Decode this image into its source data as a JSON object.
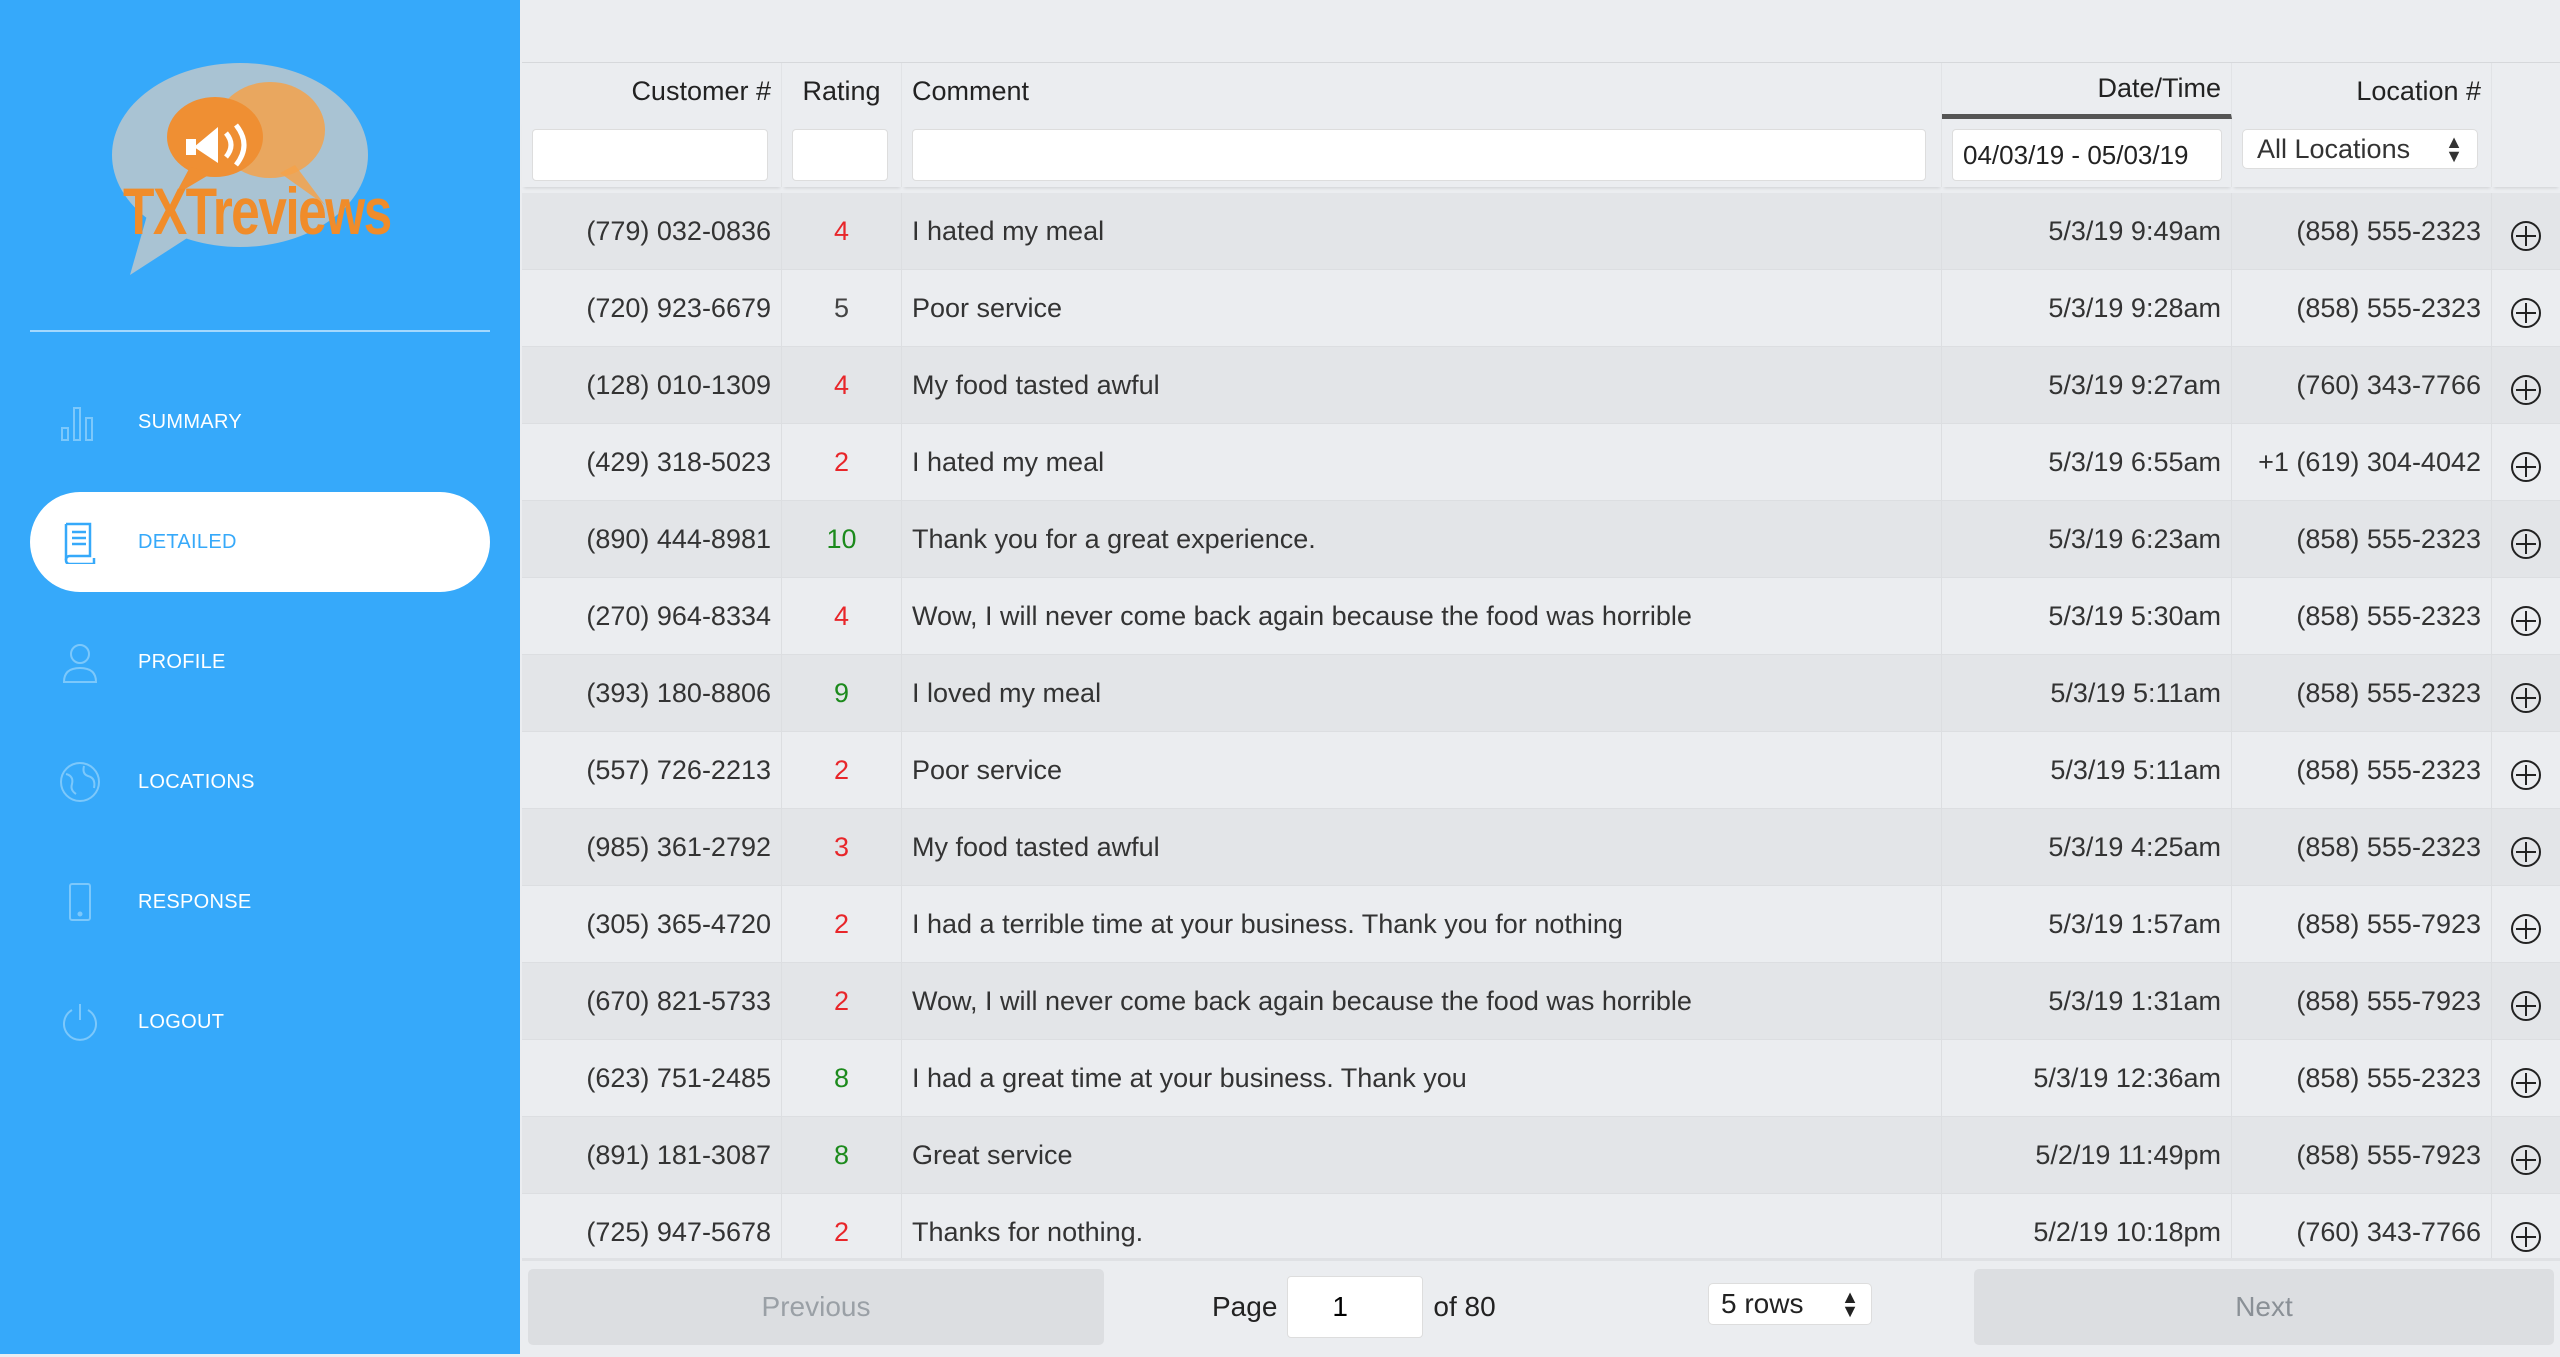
{
  "logo": {
    "text": "TXTreviews"
  },
  "nav": [
    {
      "label": "SUMMARY",
      "icon": "bar-chart-icon",
      "active": false
    },
    {
      "label": "DETAILED",
      "icon": "document-icon",
      "active": true
    },
    {
      "label": "PROFILE",
      "icon": "user-icon",
      "active": false
    },
    {
      "label": "LOCATIONS",
      "icon": "globe-icon",
      "active": false
    },
    {
      "label": "RESPONSE",
      "icon": "phone-icon",
      "active": false
    },
    {
      "label": "LOGOUT",
      "icon": "power-icon",
      "active": false
    }
  ],
  "table": {
    "headers": {
      "customer": "Customer #",
      "rating": "Rating",
      "comment": "Comment",
      "datetime": "Date/Time",
      "location": "Location #"
    },
    "filters": {
      "customer": "",
      "rating": "",
      "comment": "",
      "date_range": "04/03/19 - 05/03/19",
      "location": "All Locations"
    },
    "rows": [
      {
        "customer": "(779) 032-0836",
        "rating": "4",
        "comment": "I hated my meal",
        "datetime": "5/3/19 9:49am",
        "location": "(858) 555-2323"
      },
      {
        "customer": "(720) 923-6679",
        "rating": "5",
        "comment": "Poor service",
        "datetime": "5/3/19 9:28am",
        "location": "(858) 555-2323"
      },
      {
        "customer": "(128) 010-1309",
        "rating": "4",
        "comment": "My food tasted awful",
        "datetime": "5/3/19 9:27am",
        "location": "(760) 343-7766"
      },
      {
        "customer": "(429) 318-5023",
        "rating": "2",
        "comment": "I hated my meal",
        "datetime": "5/3/19 6:55am",
        "location": "+1 (619) 304-4042"
      },
      {
        "customer": "(890) 444-8981",
        "rating": "10",
        "comment": "Thank you for a great experience.",
        "datetime": "5/3/19 6:23am",
        "location": "(858) 555-2323"
      },
      {
        "customer": "(270) 964-8334",
        "rating": "4",
        "comment": "Wow, I will never come back again because the food was horrible",
        "datetime": "5/3/19 5:30am",
        "location": "(858) 555-2323"
      },
      {
        "customer": "(393) 180-8806",
        "rating": "9",
        "comment": "I loved my meal",
        "datetime": "5/3/19 5:11am",
        "location": "(858) 555-2323"
      },
      {
        "customer": "(557) 726-2213",
        "rating": "2",
        "comment": "Poor service",
        "datetime": "5/3/19 5:11am",
        "location": "(858) 555-2323"
      },
      {
        "customer": "(985) 361-2792",
        "rating": "3",
        "comment": "My food tasted awful",
        "datetime": "5/3/19 4:25am",
        "location": "(858) 555-2323"
      },
      {
        "customer": "(305) 365-4720",
        "rating": "2",
        "comment": "I had a terrible time at your business. Thank you for nothing",
        "datetime": "5/3/19 1:57am",
        "location": "(858) 555-7923"
      },
      {
        "customer": "(670) 821-5733",
        "rating": "2",
        "comment": "Wow, I will never come back again because the food was horrible",
        "datetime": "5/3/19 1:31am",
        "location": "(858) 555-7923"
      },
      {
        "customer": "(623) 751-2485",
        "rating": "8",
        "comment": "I had a great time at your business. Thank you",
        "datetime": "5/3/19 12:36am",
        "location": "(858) 555-2323"
      },
      {
        "customer": "(891) 181-3087",
        "rating": "8",
        "comment": "Great service",
        "datetime": "5/2/19 11:49pm",
        "location": "(858) 555-7923"
      },
      {
        "customer": "(725) 947-5678",
        "rating": "2",
        "comment": "Thanks for nothing.",
        "datetime": "5/2/19 10:18pm",
        "location": "(760) 343-7766"
      }
    ]
  },
  "pagination": {
    "previous_label": "Previous",
    "page_label": "Page",
    "current_page": "1",
    "of_label": "of 80",
    "rows_option": "5 rows",
    "next_label": "Next"
  },
  "colors": {
    "sidebar": "#36a9fa",
    "rating_low": "#e8262a",
    "rating_high": "#1c8a1c",
    "logo_text": "#f08c2a"
  }
}
